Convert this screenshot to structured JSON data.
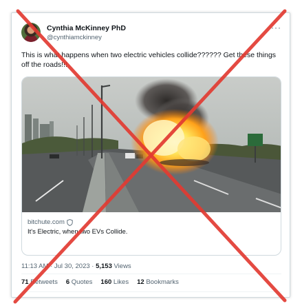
{
  "author": {
    "name": "Cynthia McKinney PhD",
    "handle": "@cynthiamckinney"
  },
  "more_glyph": "···",
  "tweet": {
    "text": "This is what happens when two electric vehicles collide?????? Get these things off the roads!!!"
  },
  "card": {
    "domain": "bitchute.com",
    "title": "It's Electric, when two EVs Collide."
  },
  "meta": {
    "time": "11:13 AM · Jul 30, 2023 · ",
    "views_count": "5,153",
    "views_label": " Views"
  },
  "stats": {
    "retweets_count": "71",
    "retweets_label": "Retweets",
    "quotes_count": "6",
    "quotes_label": "Quotes",
    "likes_count": "160",
    "likes_label": "Likes",
    "bookmarks_count": "12",
    "bookmarks_label": "Bookmarks"
  },
  "colors": {
    "cross": "#e23b32",
    "link_gray": "#536471",
    "border": "#cfd9de"
  }
}
